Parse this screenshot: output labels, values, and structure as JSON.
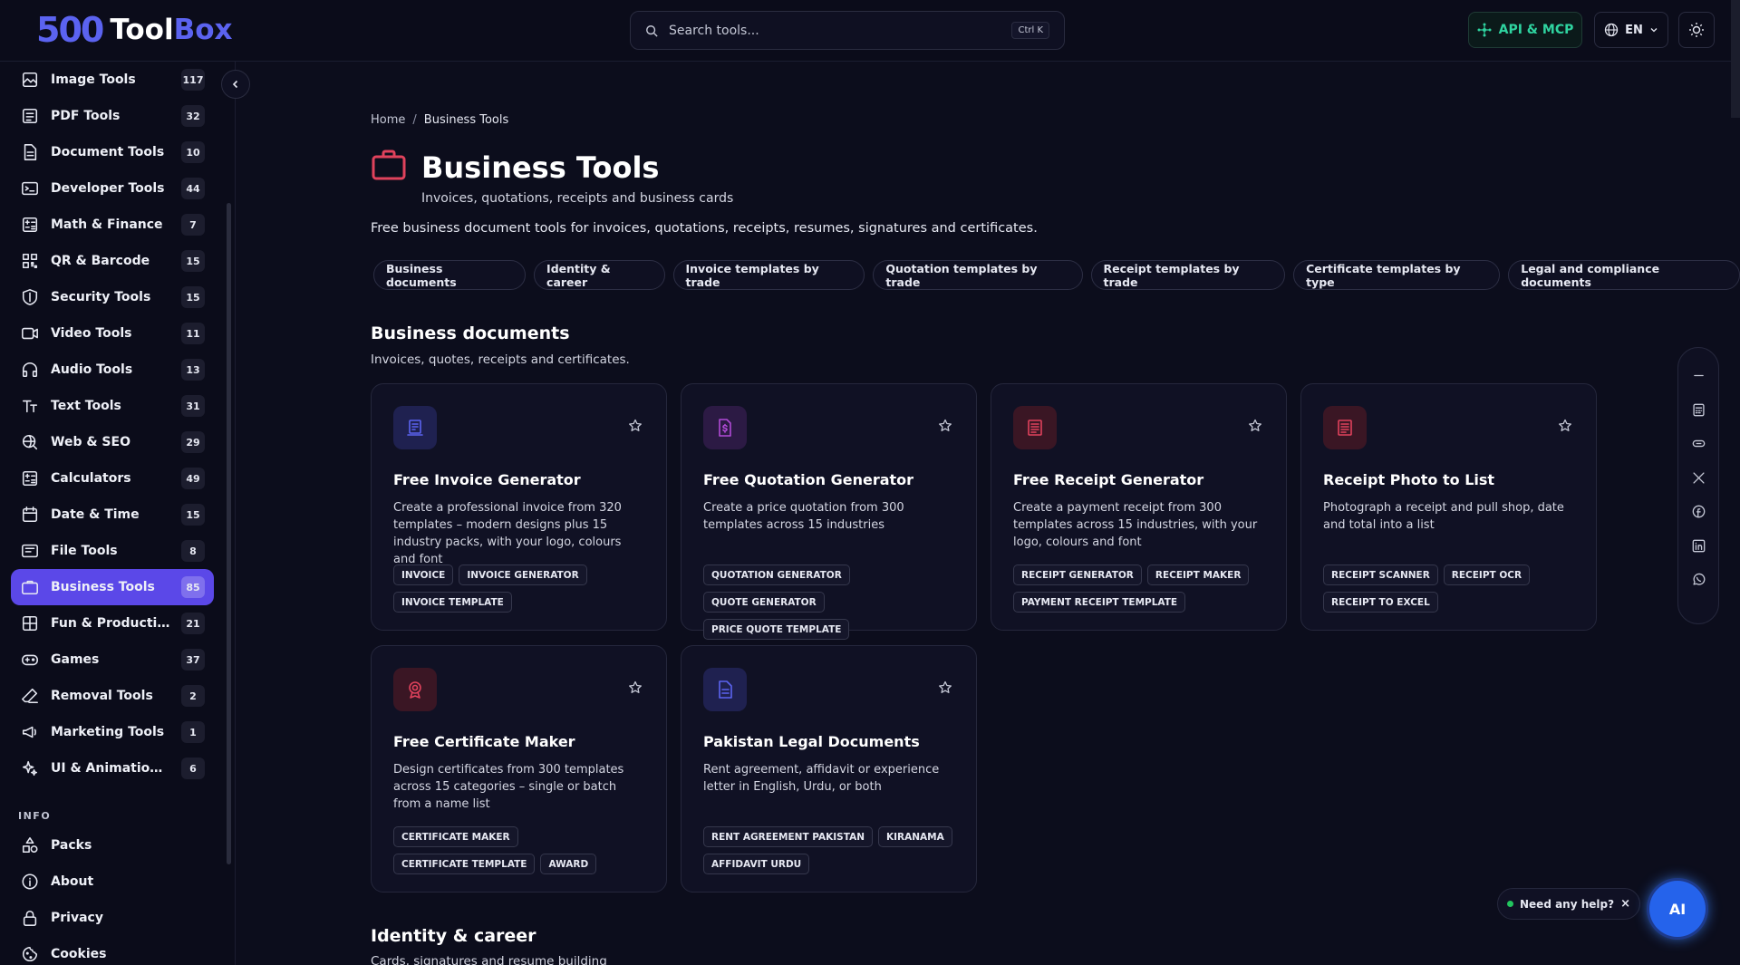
{
  "header": {
    "logo_number": "500",
    "logo_word_a": "Tool",
    "logo_word_b": "Box",
    "search_placeholder": "Search tools...",
    "search_shortcut": "Ctrl K",
    "api_label": "API & MCP",
    "lang_label": "EN"
  },
  "sidebar": {
    "items": [
      {
        "label": "Image Tools",
        "count": "117",
        "icon": "image-icon"
      },
      {
        "label": "PDF Tools",
        "count": "32",
        "icon": "pdf-icon"
      },
      {
        "label": "Document Tools",
        "count": "10",
        "icon": "document-icon"
      },
      {
        "label": "Developer Tools",
        "count": "44",
        "icon": "terminal-icon"
      },
      {
        "label": "Math & Finance",
        "count": "7",
        "icon": "calculator-icon"
      },
      {
        "label": "QR & Barcode",
        "count": "15",
        "icon": "qr-icon"
      },
      {
        "label": "Security Tools",
        "count": "15",
        "icon": "shield-icon"
      },
      {
        "label": "Video Tools",
        "count": "11",
        "icon": "video-icon"
      },
      {
        "label": "Audio Tools",
        "count": "13",
        "icon": "headphones-icon"
      },
      {
        "label": "Text Tools",
        "count": "31",
        "icon": "text-icon"
      },
      {
        "label": "Web & SEO",
        "count": "29",
        "icon": "web-search-icon"
      },
      {
        "label": "Calculators",
        "count": "49",
        "icon": "calculator-icon"
      },
      {
        "label": "Date & Time",
        "count": "15",
        "icon": "calendar-icon"
      },
      {
        "label": "File Tools",
        "count": "8",
        "icon": "file-icon"
      },
      {
        "label": "Business Tools",
        "count": "85",
        "icon": "briefcase-icon"
      },
      {
        "label": "Fun & Productivity",
        "count": "21",
        "icon": "grid-icon"
      },
      {
        "label": "Games",
        "count": "37",
        "icon": "gamepad-icon"
      },
      {
        "label": "Removal Tools",
        "count": "2",
        "icon": "eraser-icon"
      },
      {
        "label": "Marketing Tools",
        "count": "1",
        "icon": "megaphone-icon"
      },
      {
        "label": "UI & Animation Gen...",
        "count": "6",
        "icon": "sparkles-icon"
      }
    ],
    "active_index": 14,
    "info_label": "INFO",
    "info_items": [
      {
        "label": "Packs",
        "icon": "shapes-icon"
      },
      {
        "label": "About",
        "icon": "info-icon"
      },
      {
        "label": "Privacy",
        "icon": "lock-icon"
      },
      {
        "label": "Cookies",
        "icon": "cookie-icon"
      }
    ]
  },
  "breadcrumb": {
    "home": "Home",
    "sep": "/",
    "current": "Business Tools"
  },
  "page": {
    "title": "Business Tools",
    "subtitle": "Invoices, quotations, receipts and business cards",
    "description": "Free business document tools for invoices, quotations, receipts, resumes, signatures and certificates."
  },
  "chips": [
    "Business documents",
    "Identity & career",
    "Invoice templates by trade",
    "Quotation templates by trade",
    "Receipt templates by trade",
    "Certificate templates by type",
    "Legal and compliance documents"
  ],
  "section": {
    "title": "Business documents",
    "subtitle": "Invoices, quotes, receipts and certificates."
  },
  "cards": [
    {
      "title": "Free Invoice Generator",
      "desc": "Create a professional invoice from 320 templates – modern designs plus 15 industry packs, with your logo, colours and font",
      "tags": [
        "INVOICE",
        "INVOICE GENERATOR",
        "INVOICE TEMPLATE"
      ],
      "icon": "invoice-icon",
      "color": "#5b63f0",
      "bg": "#1f2150"
    },
    {
      "title": "Free Quotation Generator",
      "desc": "Create a price quotation from 300 templates across 15 industries",
      "tags": [
        "QUOTATION GENERATOR",
        "QUOTE GENERATOR",
        "PRICE QUOTE TEMPLATE"
      ],
      "icon": "dollar-file-icon",
      "color": "#b04ad6",
      "bg": "#2c1a44"
    },
    {
      "title": "Free Receipt Generator",
      "desc": "Create a payment receipt from 300 templates across 15 industries, with your logo, colours and font",
      "tags": [
        "RECEIPT GENERATOR",
        "RECEIPT MAKER",
        "PAYMENT RECEIPT TEMPLATE"
      ],
      "icon": "receipt-icon",
      "color": "#e0425c",
      "bg": "#3a1624"
    },
    {
      "title": "Receipt Photo to List",
      "desc": "Photograph a receipt and pull shop, date and total into a list",
      "tags": [
        "RECEIPT SCANNER",
        "RECEIPT OCR",
        "RECEIPT TO EXCEL"
      ],
      "icon": "receipt-icon",
      "color": "#e0425c",
      "bg": "#3a1624"
    },
    {
      "title": "Free Certificate Maker",
      "desc": "Design certificates from 300 templates across 15 categories – single or batch from a name list",
      "tags": [
        "CERTIFICATE MAKER",
        "CERTIFICATE TEMPLATE",
        "AWARD"
      ],
      "icon": "award-icon",
      "color": "#e0425c",
      "bg": "#3a1624"
    },
    {
      "title": "Pakistan Legal Documents",
      "desc": "Rent agreement, affidavit or experience letter in English, Urdu, or both",
      "tags": [
        "RENT AGREEMENT PAKISTAN",
        "KIRANAMA",
        "AFFIDAVIT URDU"
      ],
      "icon": "document-icon",
      "color": "#5b63f0",
      "bg": "#1f2150"
    }
  ],
  "section2": {
    "title": "Identity & career",
    "subtitle": "Cards, signatures and resume building"
  },
  "share": [
    "minus-icon",
    "calculator-icon",
    "link-icon",
    "x-icon",
    "facebook-icon",
    "linkedin-icon",
    "whatsapp-icon"
  ],
  "help": {
    "label": "Need any help?",
    "close": "×",
    "ai_label": "AI"
  },
  "colors": {
    "accent": "#5b48e8",
    "brand": "#5b63f0",
    "api_green": "#2fd4a0",
    "background": "#0c0d1c"
  }
}
